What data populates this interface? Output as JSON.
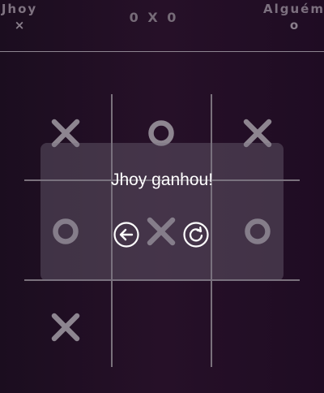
{
  "header": {
    "player1": {
      "name": "Jhoy",
      "symbol": "×"
    },
    "score": "0 X 0",
    "player2": {
      "name": "Alguém",
      "symbol": "o"
    }
  },
  "board": {
    "cells": [
      "X",
      "O",
      "X",
      "O",
      "X",
      "O",
      "X",
      "",
      ""
    ]
  },
  "result": {
    "message": "Jhoy ganhou!",
    "back_icon": "arrow-left-circle-icon",
    "restart_icon": "restart-circle-icon"
  },
  "colors": {
    "mark": "#8d8590",
    "background": "#211023",
    "text": "#ffffff"
  }
}
